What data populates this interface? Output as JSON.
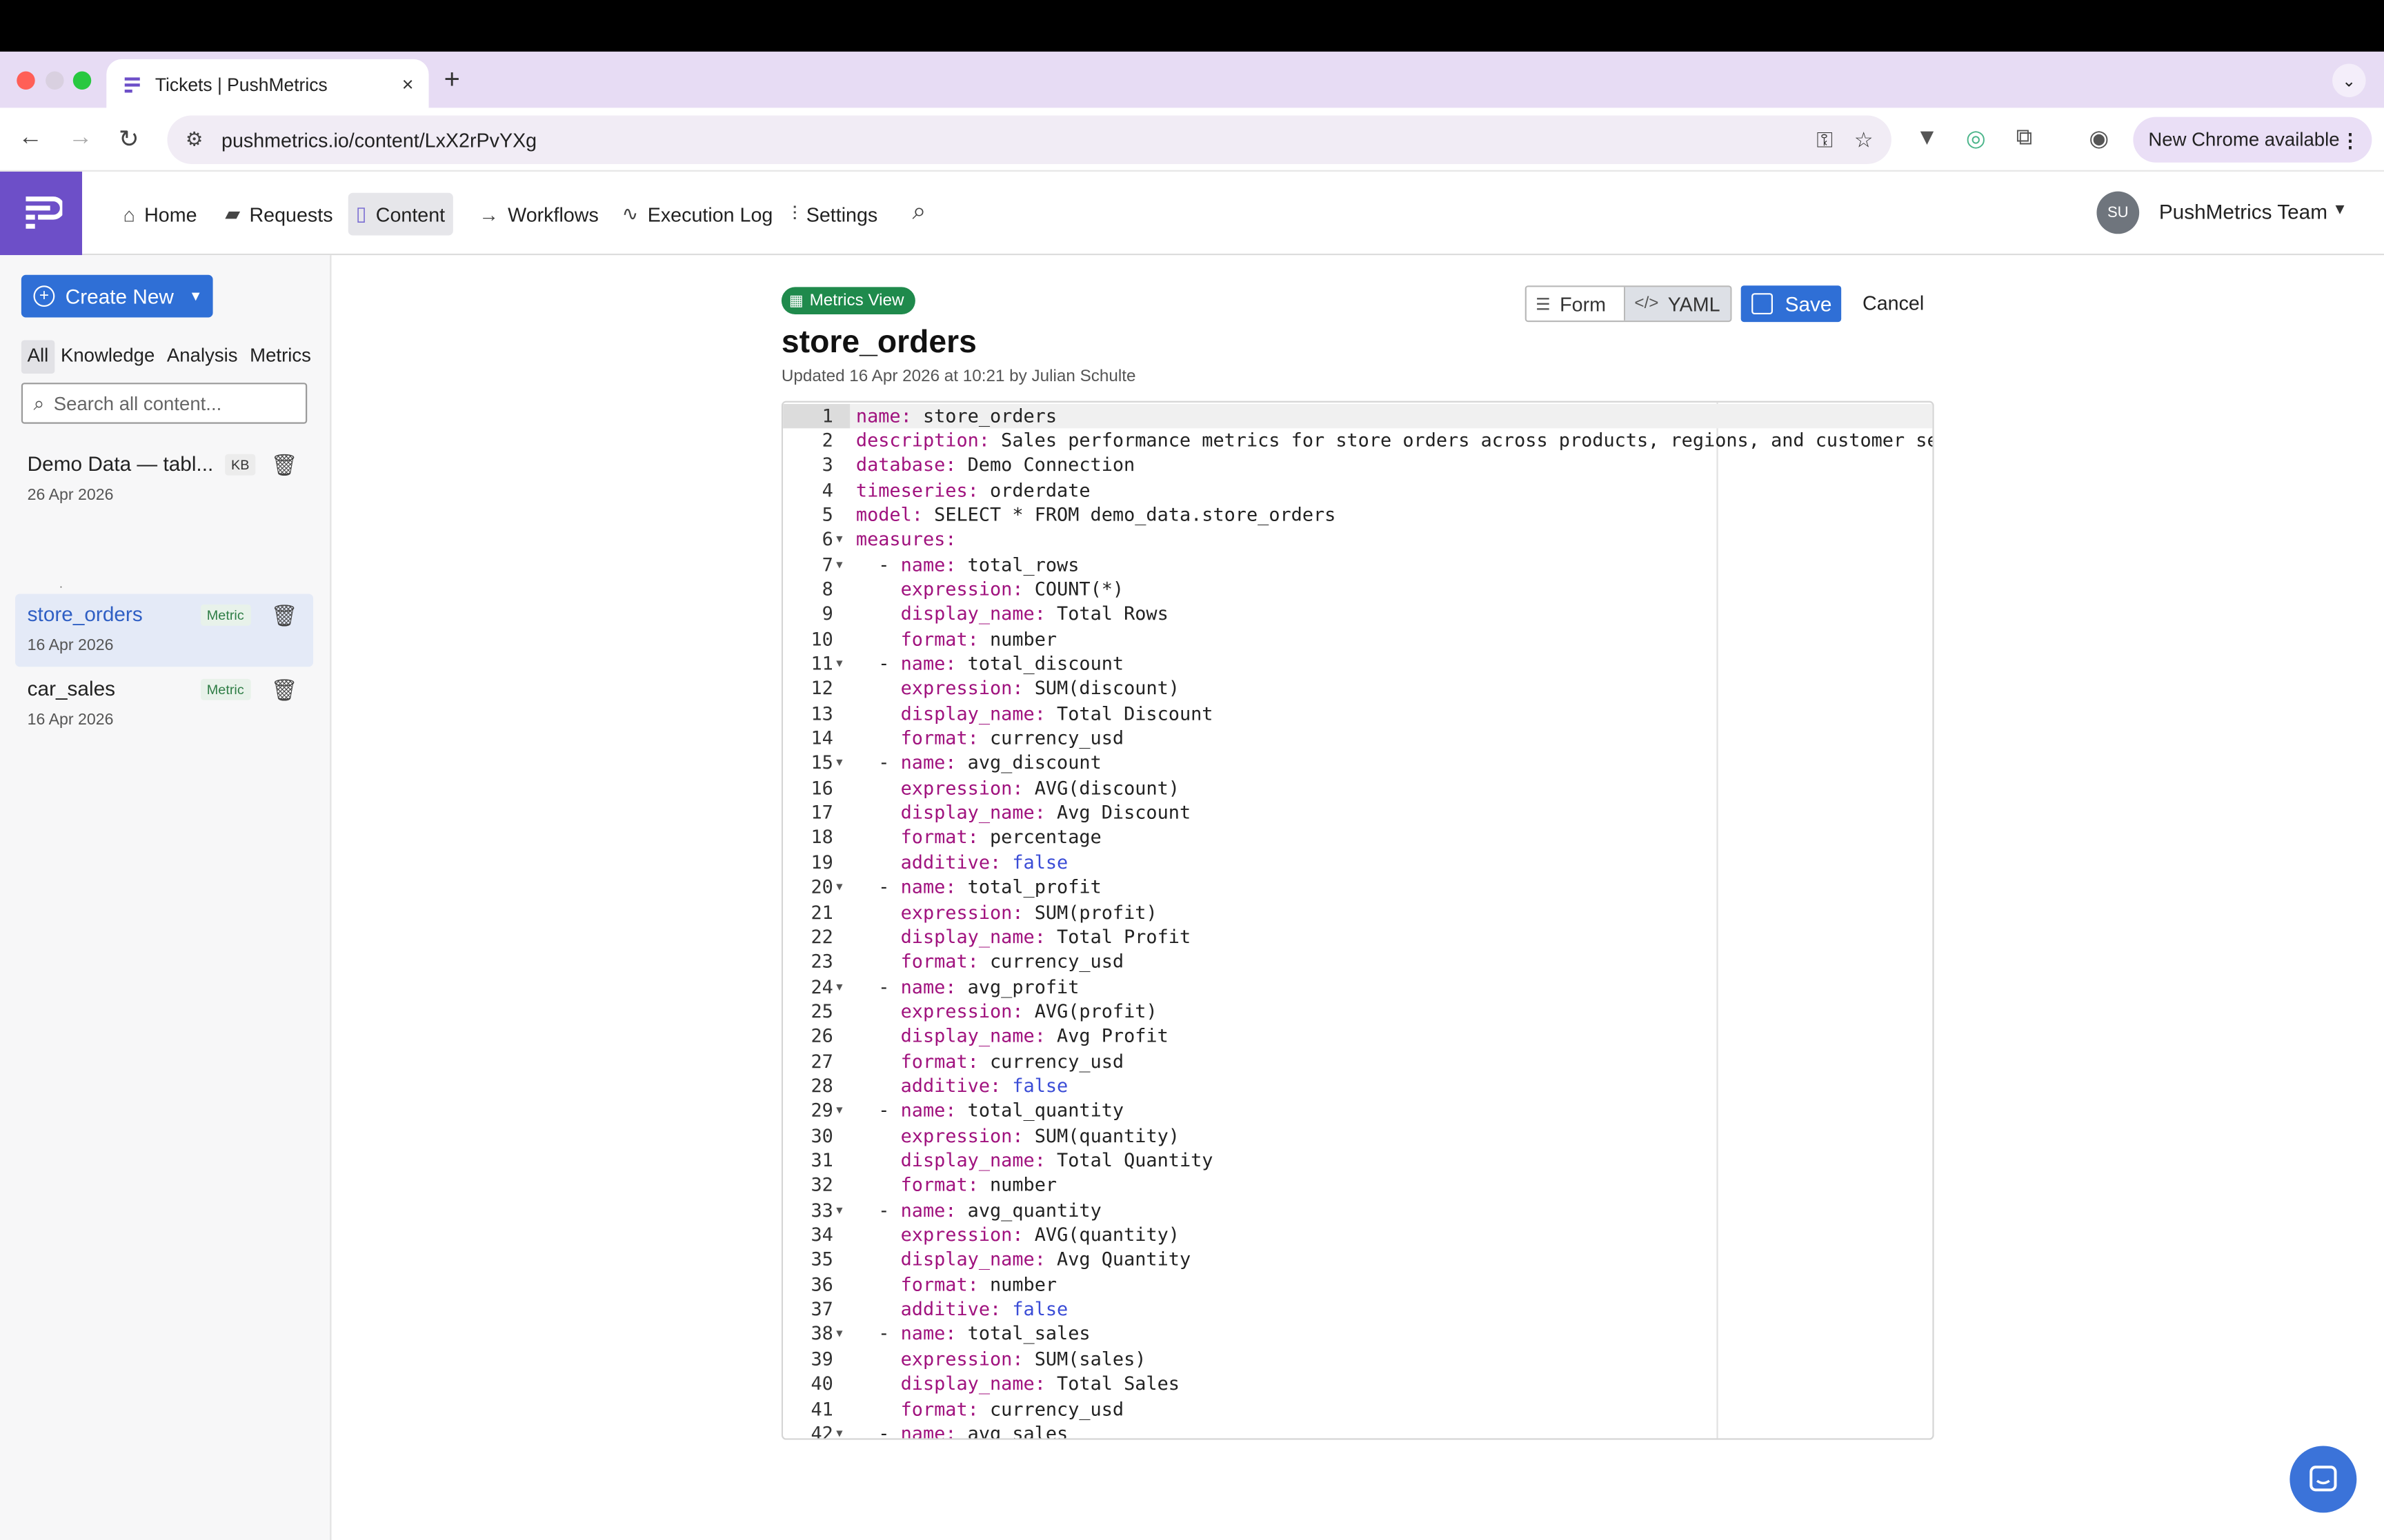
{
  "browser": {
    "tab_title": "Tickets | PushMetrics",
    "tab_close": "×",
    "new_tab": "+",
    "url": "pushmetrics.io/content/LxX2rPvYXg",
    "update_label": "New Chrome available"
  },
  "nav": {
    "items": [
      "Home",
      "Requests",
      "Content",
      "Workflows",
      "Execution Log",
      "Settings"
    ],
    "active": "Content",
    "team_initials": "SU",
    "team_name": "PushMetrics Team"
  },
  "sidebar": {
    "create_label": "Create New",
    "filters": [
      "All",
      "Knowledge",
      "Analysis",
      "Metrics"
    ],
    "search_placeholder": "Search all content...",
    "items": [
      {
        "name": "Demo Data — tabl...",
        "badge": "KB",
        "date": "26 Apr 2026"
      },
      {
        "name": "store_orders",
        "badge": "Metric",
        "date": "16 Apr 2026"
      },
      {
        "name": "car_sales",
        "badge": "Metric",
        "date": "16 Apr 2026"
      }
    ],
    "stray_mark": "."
  },
  "main": {
    "badge": "Metrics View",
    "title": "store_orders",
    "updated": "Updated 16 Apr 2026 at 10:21 by Julian Schulte",
    "form_label": "Form",
    "yaml_label": "YAML",
    "save_label": "Save",
    "cancel_label": "Cancel"
  },
  "editor": {
    "lines": [
      {
        "n": "1",
        "t": [
          [
            "k",
            "name:"
          ],
          [
            "",
            "store_orders"
          ]
        ]
      },
      {
        "n": "2",
        "t": [
          [
            "k",
            "description:"
          ],
          [
            "",
            "Sales performance metrics for store orders across products, regions, and customer segme"
          ]
        ]
      },
      {
        "n": "3",
        "t": [
          [
            "k",
            "database:"
          ],
          [
            "",
            "Demo Connection"
          ]
        ]
      },
      {
        "n": "4",
        "t": [
          [
            "k",
            "timeseries:"
          ],
          [
            "",
            "orderdate"
          ]
        ]
      },
      {
        "n": "5",
        "t": [
          [
            "k",
            "model:"
          ],
          [
            "",
            "SELECT * FROM demo_data.store_orders"
          ]
        ]
      },
      {
        "n": "6",
        "fold": true,
        "t": [
          [
            "k",
            "measures:"
          ]
        ]
      },
      {
        "n": "7",
        "fold": true,
        "t": [
          [
            "",
            "  - "
          ],
          [
            "k",
            "name:"
          ],
          [
            "",
            "total_rows"
          ]
        ]
      },
      {
        "n": "8",
        "t": [
          [
            "",
            "    "
          ],
          [
            "k",
            "expression:"
          ],
          [
            "",
            "COUNT(*)"
          ]
        ]
      },
      {
        "n": "9",
        "t": [
          [
            "",
            "    "
          ],
          [
            "k",
            "display_name:"
          ],
          [
            "",
            "Total Rows"
          ]
        ]
      },
      {
        "n": "10",
        "t": [
          [
            "",
            "    "
          ],
          [
            "k",
            "format:"
          ],
          [
            "",
            "number"
          ]
        ]
      },
      {
        "n": "11",
        "fold": true,
        "t": [
          [
            "",
            "  - "
          ],
          [
            "k",
            "name:"
          ],
          [
            "",
            "total_discount"
          ]
        ]
      },
      {
        "n": "12",
        "t": [
          [
            "",
            "    "
          ],
          [
            "k",
            "expression:"
          ],
          [
            "",
            "SUM(discount)"
          ]
        ]
      },
      {
        "n": "13",
        "t": [
          [
            "",
            "    "
          ],
          [
            "k",
            "display_name:"
          ],
          [
            "",
            "Total Discount"
          ]
        ]
      },
      {
        "n": "14",
        "t": [
          [
            "",
            "    "
          ],
          [
            "k",
            "format:"
          ],
          [
            "",
            "currency_usd"
          ]
        ]
      },
      {
        "n": "15",
        "fold": true,
        "t": [
          [
            "",
            "  - "
          ],
          [
            "k",
            "name:"
          ],
          [
            "",
            "avg_discount"
          ]
        ]
      },
      {
        "n": "16",
        "t": [
          [
            "",
            "    "
          ],
          [
            "k",
            "expression:"
          ],
          [
            "",
            "AVG(discount)"
          ]
        ]
      },
      {
        "n": "17",
        "t": [
          [
            "",
            "    "
          ],
          [
            "k",
            "display_name:"
          ],
          [
            "",
            "Avg Discount"
          ]
        ]
      },
      {
        "n": "18",
        "t": [
          [
            "",
            "    "
          ],
          [
            "k",
            "format:"
          ],
          [
            "",
            "percentage"
          ]
        ]
      },
      {
        "n": "19",
        "t": [
          [
            "",
            "    "
          ],
          [
            "k",
            "additive:"
          ],
          [
            "b",
            "false"
          ]
        ]
      },
      {
        "n": "20",
        "fold": true,
        "t": [
          [
            "",
            "  - "
          ],
          [
            "k",
            "name:"
          ],
          [
            "",
            "total_profit"
          ]
        ]
      },
      {
        "n": "21",
        "t": [
          [
            "",
            "    "
          ],
          [
            "k",
            "expression:"
          ],
          [
            "",
            "SUM(profit)"
          ]
        ]
      },
      {
        "n": "22",
        "t": [
          [
            "",
            "    "
          ],
          [
            "k",
            "display_name:"
          ],
          [
            "",
            "Total Profit"
          ]
        ]
      },
      {
        "n": "23",
        "t": [
          [
            "",
            "    "
          ],
          [
            "k",
            "format:"
          ],
          [
            "",
            "currency_usd"
          ]
        ]
      },
      {
        "n": "24",
        "fold": true,
        "t": [
          [
            "",
            "  - "
          ],
          [
            "k",
            "name:"
          ],
          [
            "",
            "avg_profit"
          ]
        ]
      },
      {
        "n": "25",
        "t": [
          [
            "",
            "    "
          ],
          [
            "k",
            "expression:"
          ],
          [
            "",
            "AVG(profit)"
          ]
        ]
      },
      {
        "n": "26",
        "t": [
          [
            "",
            "    "
          ],
          [
            "k",
            "display_name:"
          ],
          [
            "",
            "Avg Profit"
          ]
        ]
      },
      {
        "n": "27",
        "t": [
          [
            "",
            "    "
          ],
          [
            "k",
            "format:"
          ],
          [
            "",
            "currency_usd"
          ]
        ]
      },
      {
        "n": "28",
        "t": [
          [
            "",
            "    "
          ],
          [
            "k",
            "additive:"
          ],
          [
            "b",
            "false"
          ]
        ]
      },
      {
        "n": "29",
        "fold": true,
        "t": [
          [
            "",
            "  - "
          ],
          [
            "k",
            "name:"
          ],
          [
            "",
            "total_quantity"
          ]
        ]
      },
      {
        "n": "30",
        "t": [
          [
            "",
            "    "
          ],
          [
            "k",
            "expression:"
          ],
          [
            "",
            "SUM(quantity)"
          ]
        ]
      },
      {
        "n": "31",
        "t": [
          [
            "",
            "    "
          ],
          [
            "k",
            "display_name:"
          ],
          [
            "",
            "Total Quantity"
          ]
        ]
      },
      {
        "n": "32",
        "t": [
          [
            "",
            "    "
          ],
          [
            "k",
            "format:"
          ],
          [
            "",
            "number"
          ]
        ]
      },
      {
        "n": "33",
        "fold": true,
        "t": [
          [
            "",
            "  - "
          ],
          [
            "k",
            "name:"
          ],
          [
            "",
            "avg_quantity"
          ]
        ]
      },
      {
        "n": "34",
        "t": [
          [
            "",
            "    "
          ],
          [
            "k",
            "expression:"
          ],
          [
            "",
            "AVG(quantity)"
          ]
        ]
      },
      {
        "n": "35",
        "t": [
          [
            "",
            "    "
          ],
          [
            "k",
            "display_name:"
          ],
          [
            "",
            "Avg Quantity"
          ]
        ]
      },
      {
        "n": "36",
        "t": [
          [
            "",
            "    "
          ],
          [
            "k",
            "format:"
          ],
          [
            "",
            "number"
          ]
        ]
      },
      {
        "n": "37",
        "t": [
          [
            "",
            "    "
          ],
          [
            "k",
            "additive:"
          ],
          [
            "b",
            "false"
          ]
        ]
      },
      {
        "n": "38",
        "fold": true,
        "t": [
          [
            "",
            "  - "
          ],
          [
            "k",
            "name:"
          ],
          [
            "",
            "total_sales"
          ]
        ]
      },
      {
        "n": "39",
        "t": [
          [
            "",
            "    "
          ],
          [
            "k",
            "expression:"
          ],
          [
            "",
            "SUM(sales)"
          ]
        ]
      },
      {
        "n": "40",
        "t": [
          [
            "",
            "    "
          ],
          [
            "k",
            "display_name:"
          ],
          [
            "",
            "Total Sales"
          ]
        ]
      },
      {
        "n": "41",
        "t": [
          [
            "",
            "    "
          ],
          [
            "k",
            "format:"
          ],
          [
            "",
            "currency_usd"
          ]
        ]
      },
      {
        "n": "42",
        "fold": true,
        "t": [
          [
            "",
            "  - "
          ],
          [
            "k",
            "name:"
          ],
          [
            "",
            "avg_sales"
          ]
        ]
      }
    ]
  },
  "colors": {
    "accent": "#2f6fd6",
    "brand": "#6d4fc8",
    "badge_green": "#1f8a4c",
    "yaml_key": "#a0127e",
    "yaml_bool": "#3a4cd6"
  }
}
